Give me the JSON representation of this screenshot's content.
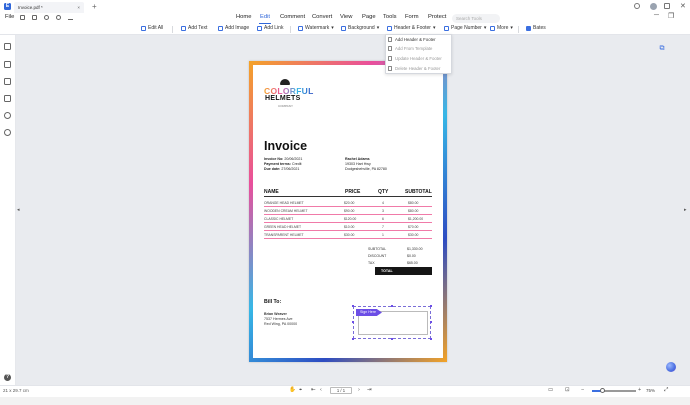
{
  "titlebar": {
    "tab_title": "Invoice.pdf *",
    "tab_close": "×",
    "new_tab": "+",
    "app_logo": "E",
    "win_controls": [
      "─",
      "❐",
      "✕"
    ],
    "win_icons": [
      "bell-icon",
      "avatar-icon",
      "user-icon"
    ]
  },
  "menubar": {
    "file": "File",
    "items": [
      "Home",
      "Edit",
      "Comment",
      "Convert",
      "View",
      "Page",
      "Tools",
      "Form",
      "Protect"
    ],
    "active": "Edit",
    "search_placeholder": "Search Tools"
  },
  "toolbar": {
    "edit_all": "Edit All",
    "add_text": "Add Text",
    "add_image": "Add Image",
    "add_link": "Add Link",
    "watermark": "Watermark",
    "background": "Background",
    "header_footer": "Header & Footer",
    "page_number": "Page Number",
    "more": "More",
    "bates": "Bates"
  },
  "hf_menu": {
    "items": [
      "Add Header & Footer",
      "Add From Template",
      "Update Header & Footer",
      "Delete Header & Footer"
    ]
  },
  "document": {
    "logo_line1": "COLORFUL",
    "logo_line2": "HELMETS",
    "logo_sub": "COMPANY",
    "title": "Invoice",
    "invoice_no_label": "Invoice No:",
    "invoice_no": "20/06/2021",
    "payment_terms_label": "Payment terms:",
    "payment_terms": "Credit",
    "due_date_label": "Due date:",
    "due_date": "27/06/2021",
    "client_name": "Rachel Adams",
    "client_addr1": "19303 Hart Hwy",
    "client_addr2": "Dodgeshehville, PA 82780",
    "table_headers": {
      "name": "NAME",
      "price": "PRICE",
      "qty": "QTY",
      "subtotal": "SUBTOTAL"
    },
    "rows": [
      {
        "name": "ORANGE HEAD HELMET",
        "price": "$20.00",
        "qty": "4",
        "subtotal": "$80.00"
      },
      {
        "name": "WOODEN CREAM HELMET",
        "price": "$90.00",
        "qty": "3",
        "subtotal": "$80.00"
      },
      {
        "name": "CLASSIC HELMET",
        "price": "$120.00",
        "qty": "6",
        "subtotal": "$1,200.00"
      },
      {
        "name": "GREEN HEAD HELMET",
        "price": "$10.00",
        "qty": "7",
        "subtotal": "$70.00"
      },
      {
        "name": "TRANSPARENT HELMET",
        "price": "$30.00",
        "qty": "1",
        "subtotal": "$30.00"
      }
    ],
    "subtotal_label": "SUBTOTAL",
    "subtotal_value": "$1,330.00",
    "discount_label": "DISCOUNT",
    "discount_value": "$0.00",
    "tax_label": "TAX",
    "tax_value": "$65.00",
    "total_label": "TOTAL",
    "bill_to": "Bill To:",
    "bill_name": "Brian Weaver",
    "bill_addr1": "7537 Hermes Ave",
    "bill_addr2": "Red Wing, PA 00000",
    "sign_here": "Sign Here"
  },
  "statusbar": {
    "page_size": "21 x 29.7 cm",
    "page_indicator": "1 / 1",
    "zoom": "75%"
  }
}
